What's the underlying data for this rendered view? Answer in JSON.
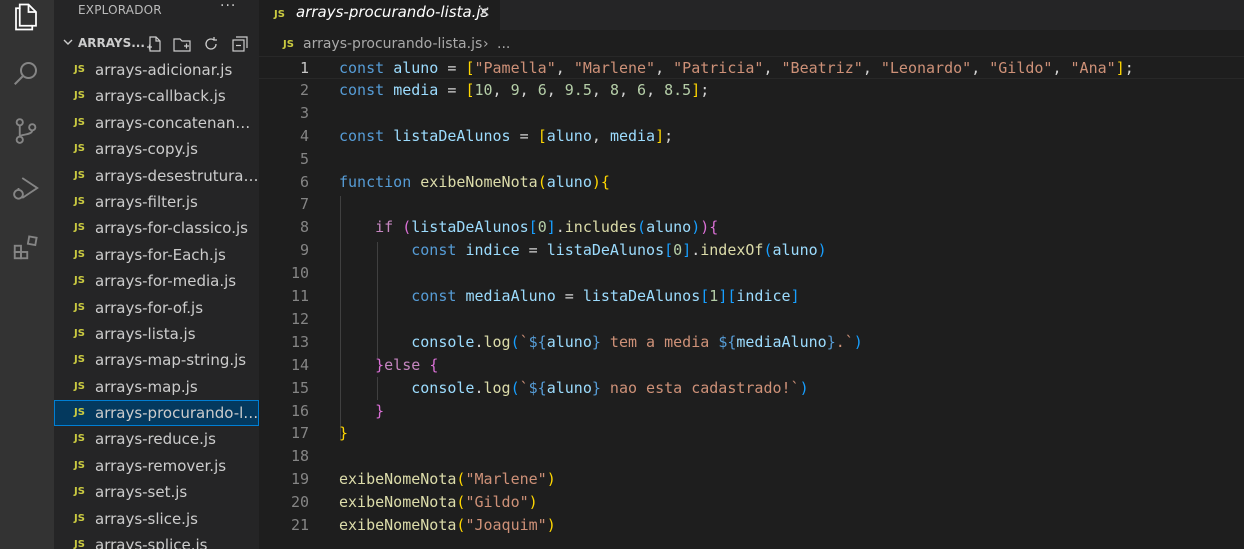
{
  "sidebar": {
    "title": "EXPLORADOR",
    "folder": "ARRAYS...",
    "files": [
      "arrays-adicionar.js",
      "arrays-callback.js",
      "arrays-concatenando.js",
      "arrays-copy.js",
      "arrays-desestruturando.js",
      "arrays-filter.js",
      "arrays-for-classico.js",
      "arrays-for-Each.js",
      "arrays-for-media.js",
      "arrays-for-of.js",
      "arrays-lista.js",
      "arrays-map-string.js",
      "arrays-map.js",
      "arrays-procurando-lista.js",
      "arrays-reduce.js",
      "arrays-remover.js",
      "arrays-set.js",
      "arrays-slice.js",
      "arrays-splice.js"
    ],
    "active_file_index": 13,
    "file_badge": "JS"
  },
  "tab": {
    "label": "arrays-procurando-lista.js",
    "badge": "JS",
    "close_glyph": "✕"
  },
  "breadcrumb": {
    "badge": "JS",
    "file": "arrays-procurando-lista.js",
    "separator": "›",
    "more": "..."
  },
  "editor": {
    "current_line": 1,
    "lines": [
      [
        [
          "kw",
          "const "
        ],
        [
          "var",
          "aluno"
        ],
        [
          "txt",
          " = "
        ],
        [
          "br1",
          "["
        ],
        [
          "str",
          "\"Pamella\""
        ],
        [
          "txt",
          ", "
        ],
        [
          "str",
          "\"Marlene\""
        ],
        [
          "txt",
          ", "
        ],
        [
          "str",
          "\"Patricia\""
        ],
        [
          "txt",
          ", "
        ],
        [
          "str",
          "\"Beatriz\""
        ],
        [
          "txt",
          ", "
        ],
        [
          "str",
          "\"Leonardo\""
        ],
        [
          "txt",
          ", "
        ],
        [
          "str",
          "\"Gildo\""
        ],
        [
          "txt",
          ", "
        ],
        [
          "str",
          "\"Ana\""
        ],
        [
          "br1",
          "]"
        ],
        [
          "txt",
          ";"
        ]
      ],
      [
        [
          "kw",
          "const "
        ],
        [
          "var",
          "media"
        ],
        [
          "txt",
          " = "
        ],
        [
          "br1",
          "["
        ],
        [
          "num",
          "10"
        ],
        [
          "txt",
          ", "
        ],
        [
          "num",
          "9"
        ],
        [
          "txt",
          ", "
        ],
        [
          "num",
          "6"
        ],
        [
          "txt",
          ", "
        ],
        [
          "num",
          "9.5"
        ],
        [
          "txt",
          ", "
        ],
        [
          "num",
          "8"
        ],
        [
          "txt",
          ", "
        ],
        [
          "num",
          "6"
        ],
        [
          "txt",
          ", "
        ],
        [
          "num",
          "8.5"
        ],
        [
          "br1",
          "]"
        ],
        [
          "txt",
          ";"
        ]
      ],
      [],
      [
        [
          "kw",
          "const "
        ],
        [
          "var",
          "listaDeAlunos"
        ],
        [
          "txt",
          " = "
        ],
        [
          "br1",
          "["
        ],
        [
          "var",
          "aluno"
        ],
        [
          "txt",
          ", "
        ],
        [
          "var",
          "media"
        ],
        [
          "br1",
          "]"
        ],
        [
          "txt",
          ";"
        ]
      ],
      [],
      [
        [
          "kw",
          "function "
        ],
        [
          "fn",
          "exibeNomeNota"
        ],
        [
          "br1",
          "("
        ],
        [
          "var",
          "aluno"
        ],
        [
          "br1",
          ")"
        ],
        [
          "br1",
          "{"
        ]
      ],
      [],
      [
        [
          "txt",
          "    "
        ],
        [
          "ctl",
          "if "
        ],
        [
          "br2",
          "("
        ],
        [
          "var",
          "listaDeAlunos"
        ],
        [
          "br3",
          "["
        ],
        [
          "num",
          "0"
        ],
        [
          "br3",
          "]"
        ],
        [
          "txt",
          "."
        ],
        [
          "fn",
          "includes"
        ],
        [
          "br3",
          "("
        ],
        [
          "var",
          "aluno"
        ],
        [
          "br3",
          ")"
        ],
        [
          "br2",
          ")"
        ],
        [
          "br2",
          "{"
        ]
      ],
      [
        [
          "txt",
          "        "
        ],
        [
          "kw",
          "const "
        ],
        [
          "var",
          "indice"
        ],
        [
          "txt",
          " = "
        ],
        [
          "var",
          "listaDeAlunos"
        ],
        [
          "br3",
          "["
        ],
        [
          "num",
          "0"
        ],
        [
          "br3",
          "]"
        ],
        [
          "txt",
          "."
        ],
        [
          "fn",
          "indexOf"
        ],
        [
          "br3",
          "("
        ],
        [
          "var",
          "aluno"
        ],
        [
          "br3",
          ")"
        ]
      ],
      [],
      [
        [
          "txt",
          "        "
        ],
        [
          "kw",
          "const "
        ],
        [
          "var",
          "mediaAluno"
        ],
        [
          "txt",
          " = "
        ],
        [
          "var",
          "listaDeAlunos"
        ],
        [
          "br3",
          "["
        ],
        [
          "num",
          "1"
        ],
        [
          "br3",
          "]"
        ],
        [
          "br3",
          "["
        ],
        [
          "var",
          "indice"
        ],
        [
          "br3",
          "]"
        ]
      ],
      [],
      [
        [
          "txt",
          "        "
        ],
        [
          "var",
          "console"
        ],
        [
          "txt",
          "."
        ],
        [
          "fn",
          "log"
        ],
        [
          "br3",
          "("
        ],
        [
          "str",
          "`"
        ],
        [
          "kw",
          "${"
        ],
        [
          "var",
          "aluno"
        ],
        [
          "kw",
          "}"
        ],
        [
          "str",
          " tem a media "
        ],
        [
          "kw",
          "${"
        ],
        [
          "var",
          "mediaAluno"
        ],
        [
          "kw",
          "}"
        ],
        [
          "str",
          ".`"
        ],
        [
          "br3",
          ")"
        ]
      ],
      [
        [
          "txt",
          "    "
        ],
        [
          "br2",
          "}"
        ],
        [
          "ctl",
          "else "
        ],
        [
          "br2",
          "{"
        ]
      ],
      [
        [
          "txt",
          "        "
        ],
        [
          "var",
          "console"
        ],
        [
          "txt",
          "."
        ],
        [
          "fn",
          "log"
        ],
        [
          "br3",
          "("
        ],
        [
          "str",
          "`"
        ],
        [
          "kw",
          "${"
        ],
        [
          "var",
          "aluno"
        ],
        [
          "kw",
          "}"
        ],
        [
          "str",
          " nao esta cadastrado!`"
        ],
        [
          "br3",
          ")"
        ]
      ],
      [
        [
          "txt",
          "    "
        ],
        [
          "br2",
          "}"
        ]
      ],
      [
        [
          "br1",
          "}"
        ]
      ],
      [],
      [
        [
          "fn",
          "exibeNomeNota"
        ],
        [
          "br1",
          "("
        ],
        [
          "str",
          "\"Marlene\""
        ],
        [
          "br1",
          ")"
        ]
      ],
      [
        [
          "fn",
          "exibeNomeNota"
        ],
        [
          "br1",
          "("
        ],
        [
          "str",
          "\"Gildo\""
        ],
        [
          "br1",
          ")"
        ]
      ],
      [
        [
          "fn",
          "exibeNomeNota"
        ],
        [
          "br1",
          "("
        ],
        [
          "str",
          "\"Joaquim\""
        ],
        [
          "br1",
          ")"
        ]
      ]
    ]
  },
  "colors": {
    "activity_bar": "#333333",
    "sidebar": "#252526",
    "editor": "#1e1e1e",
    "selection": "#04395e",
    "focus_border": "#007fd4",
    "js_badge": "#cbcb41"
  },
  "icons": {
    "activity": [
      "files-icon",
      "search-icon",
      "source-control-icon",
      "run-debug-icon",
      "extensions-icon"
    ],
    "folder_actions": [
      "new-file-icon",
      "new-folder-icon",
      "refresh-icon",
      "collapse-all-icon"
    ]
  }
}
